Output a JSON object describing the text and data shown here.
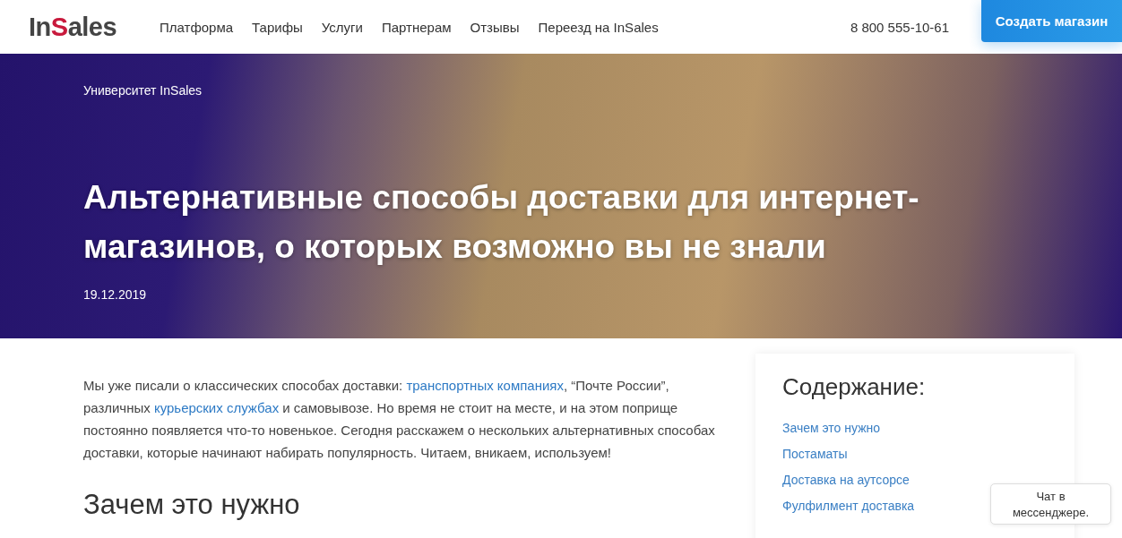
{
  "header": {
    "logo": [
      {
        "text": "In",
        "accent": false
      },
      {
        "text": "S",
        "accent": true
      },
      {
        "text": "ales",
        "accent": false
      }
    ],
    "nav": [
      "Платформа",
      "Тарифы",
      "Услуги",
      "Партнерам",
      "Отзывы",
      "Переезд на InSales"
    ],
    "phone": "8 800 555-10-61",
    "cta": "Создать магазин"
  },
  "hero": {
    "breadcrumb": "Университет InSales",
    "title": "Альтернативные способы доставки для интернет-магазинов, о которых возможно вы не знали",
    "date": "19.12.2019"
  },
  "article": {
    "intro": [
      {
        "text": "Мы уже писали о классических способах доставки: ",
        "link": false
      },
      {
        "text": "транспортных компаниях",
        "link": true
      },
      {
        "text": ", “Почте России”, различных ",
        "link": false
      },
      {
        "text": "курьерских службах",
        "link": true
      },
      {
        "text": " и самовывозе. Но время не стоит на месте, и на этом поприще постоянно появляется что-то новенькое. Сегодня расскажем о нескольких альтернативных способах доставки, которые начинают набирать популярность. Читаем, вникаем, используем!",
        "link": false
      }
    ],
    "heading": "Зачем это нужно"
  },
  "toc": {
    "title": "Содержание:",
    "items": [
      "Зачем это нужно",
      "Постаматы",
      "Доставка на аутсорсе",
      "Фулфилмент доставка"
    ]
  },
  "chat": {
    "label": "Чат в мессенджере."
  }
}
